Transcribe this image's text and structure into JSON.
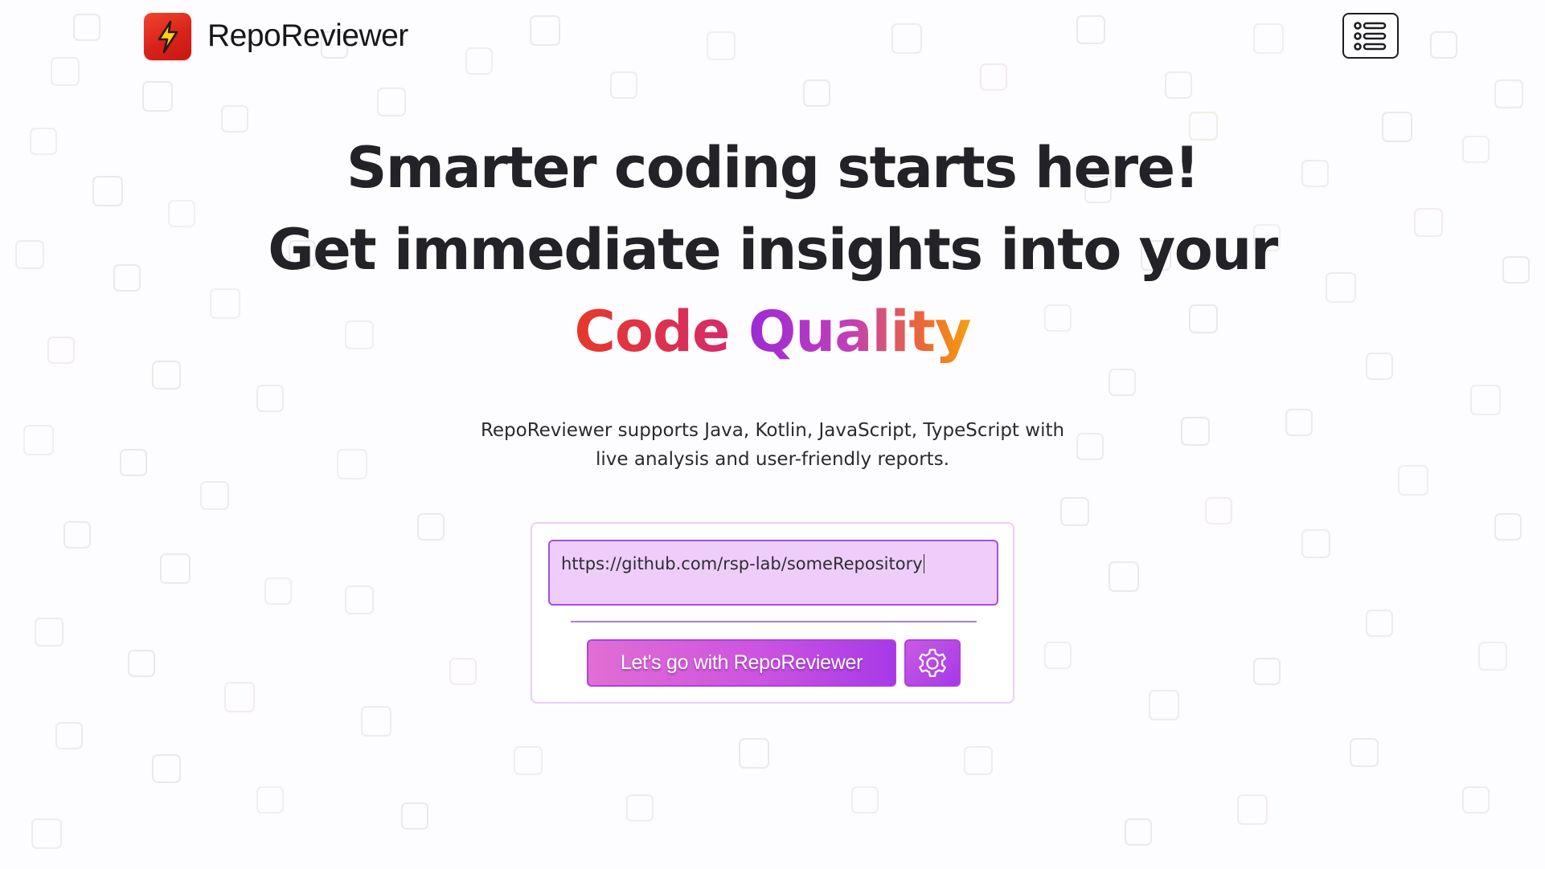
{
  "header": {
    "brand_name": "RepoReviewer",
    "logo_icon": "lightning-bolt-icon",
    "menu_icon": "list-menu-icon"
  },
  "hero": {
    "line1": "Smarter coding starts here!",
    "line2": "Get immediate insights into your",
    "accent_word1": "Code",
    "accent_word2": "Quality"
  },
  "subtitle": {
    "line1": "RepoReviewer supports Java, Kotlin, JavaScript, TypeScript with",
    "line2": "live analysis and user-friendly reports."
  },
  "form": {
    "url_value": "https://github.com/rsp-lab/someRepository",
    "submit_label": "Let's go with RepoReviewer",
    "settings_icon": "gear-icon"
  },
  "colors": {
    "brand_red": "#d8231b",
    "accent_purple": "#a53ae6",
    "input_bg": "#efcdfa",
    "text_dark": "#222228"
  }
}
